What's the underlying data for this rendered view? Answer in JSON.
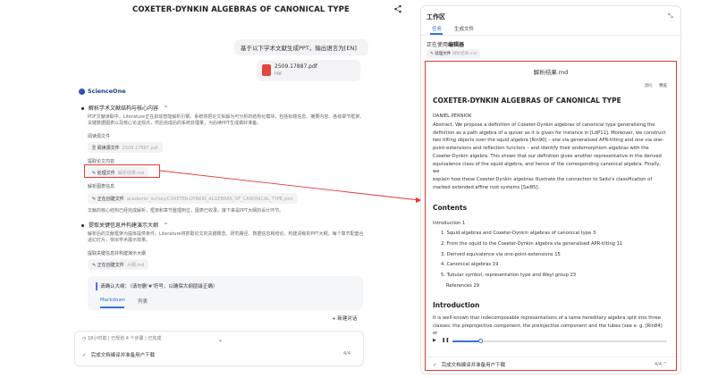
{
  "header": {
    "title": "COXETER-DYNKIN ALGEBRAS OF CANONICAL TYPE",
    "share_icon": "share-icon"
  },
  "chat": {
    "user_message": "基于以下学术文献生成PPT，输出语言为[EN]",
    "attachment": {
      "name": "2509.17887.pdf",
      "type": "PDF"
    },
    "brand": "ScienceOne",
    "steps": [
      {
        "title": "解析学术文献结构与核心内容",
        "chevron": "^",
        "description": "PDF文献读取中，Literature正在启动智能解析引擎。系统将把论文拆解为可分析的结构化模块，包括标题信息、摘要内容、各级章节框架、关键数据图表以及核心论证观点，然后完成后的系统处理量，为后续PPT生成做好准备。",
        "sub1": "阅读源文件",
        "chip1": {
          "label": "阅读源文件",
          "value": "2509.17887.pdf"
        },
        "sub2": "提取论文内容",
        "chip2": {
          "label": "处理文件",
          "value": "解析结果.md"
        },
        "sub3": "解析图表信息",
        "chip3": {
          "label": "正在创建文件",
          "value": "academic_survey/COXETER-DYNKIN_ALGEBRAS_OF_CANONICAL_TYPE.json"
        },
        "footer": "文献的核心结构已经完成解析，框架和章节整理到位，图表已收录。接下来是PPT大纲的设计环节。"
      },
      {
        "title": "提取关键信息并构建演示大纲",
        "chevron": "^",
        "description": "解析后的文献框架为提炼提供条件，Literature将抓取论文的关键概念、研究路径、数据信息和结论，构建清晰的PPT大纲，每个章节配套合适幻灯片，突出学术展示效果。",
        "sub1": "提取关键信息并构建演示大纲",
        "chip1": {
          "label": "正在创建文件",
          "value": "大纲.md"
        }
      }
    ],
    "outline_card": {
      "title": "请确认大纲：（请勿删'#'符号，以确保大纲层级正确）",
      "tabs": [
        "Markdown",
        "列表"
      ]
    },
    "new_chat": "+ 新建对话",
    "composer": {
      "status": "18小时前 | 已规划 4 个步骤 | 已完成",
      "task": "完成文档编译并准备用户下载",
      "count": "4/4"
    }
  },
  "workspace": {
    "title": "工作区",
    "tabs": [
      "任务",
      "生成文件"
    ],
    "using_label": "正在使用",
    "using_tool": "编辑器",
    "chip": {
      "label": "处理文件",
      "value": "解析结果.md"
    },
    "viewer": {
      "filename": "解析结果.md",
      "buttons": [
        "源码",
        "预览"
      ],
      "doc": {
        "title": "COXETER-DYNKIN ALGEBRAS OF CANONICAL TYPE",
        "author": "DANIEL PERNIOK",
        "abstract_lines": [
          "Abstract. We propose a definition of Coxeter-Dynkin algebras of canonical type generalising the",
          "definition as a path algebra of a quiver as it is given for instance in [LdP11]. Moreover, we construct",
          "two tilting objects over the squid algebra [Rin90] – one via generalised APR-tilting and one via one-",
          "point-extensions and reflection functors – and identify their endomorphism algebras with the",
          "Coxeter-Dynkin algebra. This shows that our definition gives another representative in the derived",
          "equivalence class of the squid algebra, and hence of the corresponding canonical algebra. Finally, we",
          "explain how these Coxeter-Dynkin algebras illustrate the connection to Saito's classification of",
          "marked extended affine root systems [Sai85]."
        ],
        "contents_heading": "Contents",
        "toc": [
          "Introduction 1",
          "1. Squid algebras and Coxeter-Dynkin algebras of canonical type 3",
          "2. From the squid to the Coxeter-Dynkin algebra via generalised APR-tilting 11",
          "3. Derived equivalence via one-point-extensions 15",
          "4. Canonical algebras 19",
          "5. Tubular symbol, representation type and Weyl group 23",
          "References 29"
        ],
        "intro_heading": "Introduction",
        "intro_lines": [
          "It is well-known that indecomposable representations of a tame hereditary algebra split into three",
          "classes: the preprojective component, the preinjective component and the tubes (see e. g. [Rin84] or"
        ]
      },
      "player": {
        "progress": 0.13
      },
      "footer_task": "完成文档编译并准备用户下载",
      "footer_count": "4/4"
    }
  },
  "colors": {
    "accent": "#3b6fe0",
    "highlight": "#e53935",
    "brand": "#1d3a8a",
    "pdf": "#e0473e"
  }
}
